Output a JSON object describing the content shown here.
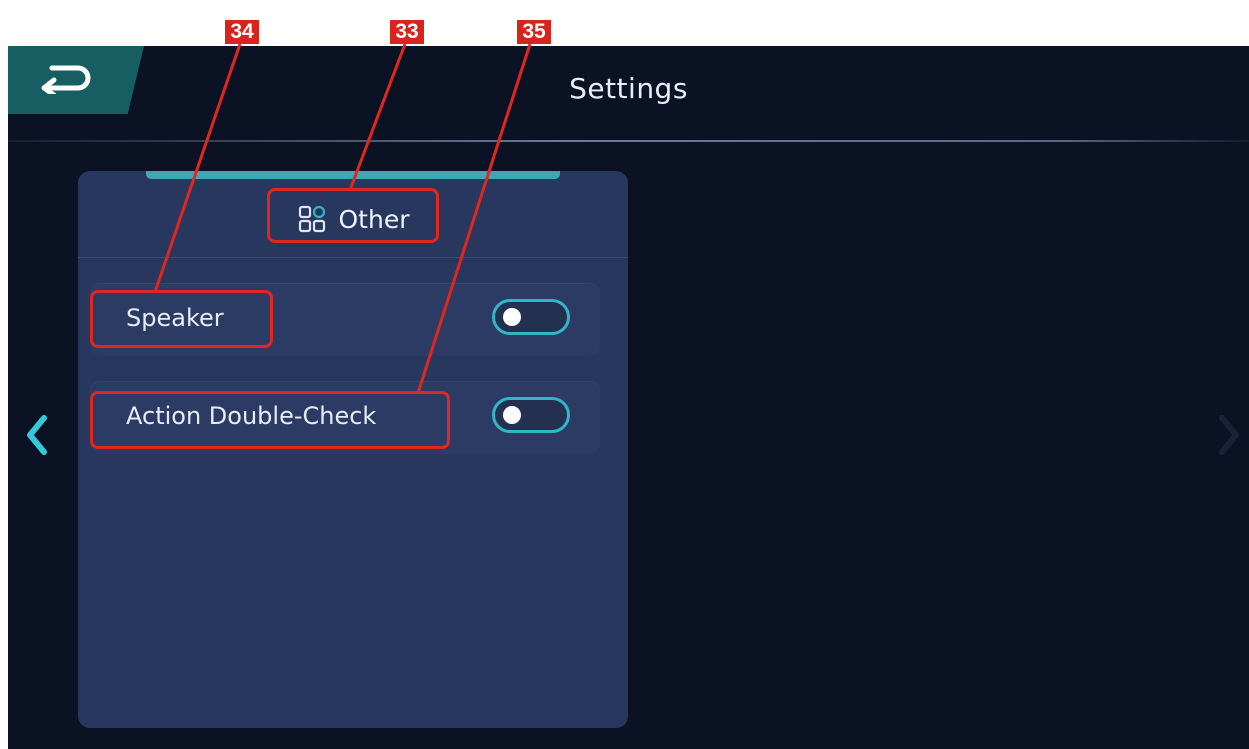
{
  "header": {
    "title": "Settings"
  },
  "icons": {
    "back": "back-arrow-icon",
    "prev": "chevron-left-icon",
    "next": "chevron-right-icon",
    "category": "grid-apps-icon"
  },
  "panel": {
    "title": "Other",
    "items": [
      {
        "label": "Speaker",
        "toggle_on": false
      },
      {
        "label": "Action Double-Check",
        "toggle_on": false
      }
    ]
  },
  "annotations": [
    {
      "number": "34"
    },
    {
      "number": "33"
    },
    {
      "number": "35"
    }
  ],
  "colors": {
    "background": "#0b1224",
    "panel": "#28375d",
    "accent": "#2fb7c8",
    "back_button": "#175e63",
    "callout": "#e0261f"
  }
}
